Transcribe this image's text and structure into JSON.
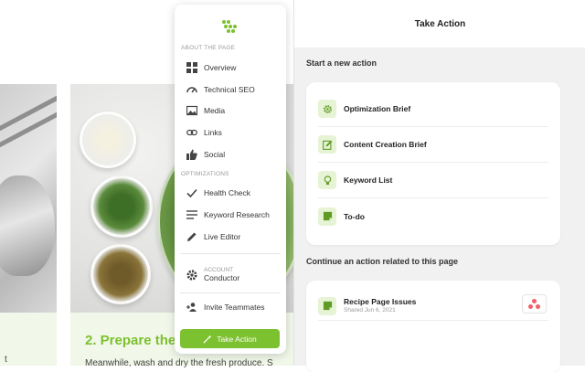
{
  "background": {
    "step_title": "2. Prepare the",
    "step_text": "Meanwhile, wash and dry the fresh produce. S",
    "left_fragment": "t"
  },
  "sidebar": {
    "logo_icon": "hex-dots-logo",
    "about_label": "ABOUT THE PAGE",
    "about_items": [
      {
        "label": "Overview",
        "icon": "grid-icon"
      },
      {
        "label": "Technical SEO",
        "icon": "gauge-icon"
      },
      {
        "label": "Media",
        "icon": "image-icon"
      },
      {
        "label": "Links",
        "icon": "link-icon"
      },
      {
        "label": "Social",
        "icon": "thumbs-up-icon"
      }
    ],
    "optimizations_label": "OPTIMIZATIONS",
    "optimization_items": [
      {
        "label": "Health Check",
        "icon": "check-icon"
      },
      {
        "label": "Keyword Research",
        "icon": "lines-icon"
      },
      {
        "label": "Live Editor",
        "icon": "pencil-icon"
      }
    ],
    "account_label": "ACCOUNT",
    "account_name": "Conductor",
    "invite_label": "Invite Teammates",
    "take_action_label": "Take Action",
    "accent_color": "#7cc12f"
  },
  "panel": {
    "title": "Take Action",
    "new_action_title": "Start a new action",
    "new_actions": [
      {
        "label": "Optimization Brief",
        "icon": "gear-icon"
      },
      {
        "label": "Content Creation Brief",
        "icon": "edit-icon"
      },
      {
        "label": "Keyword List",
        "icon": "lightbulb-icon"
      },
      {
        "label": "To-do",
        "icon": "note-icon"
      }
    ],
    "continue_title": "Continue an action related to this page",
    "continue_items": [
      {
        "title": "Recipe Page Issues",
        "subtitle": "Shared Jun 6, 2021",
        "icon": "note-icon",
        "badge": "asana-icon"
      }
    ]
  }
}
